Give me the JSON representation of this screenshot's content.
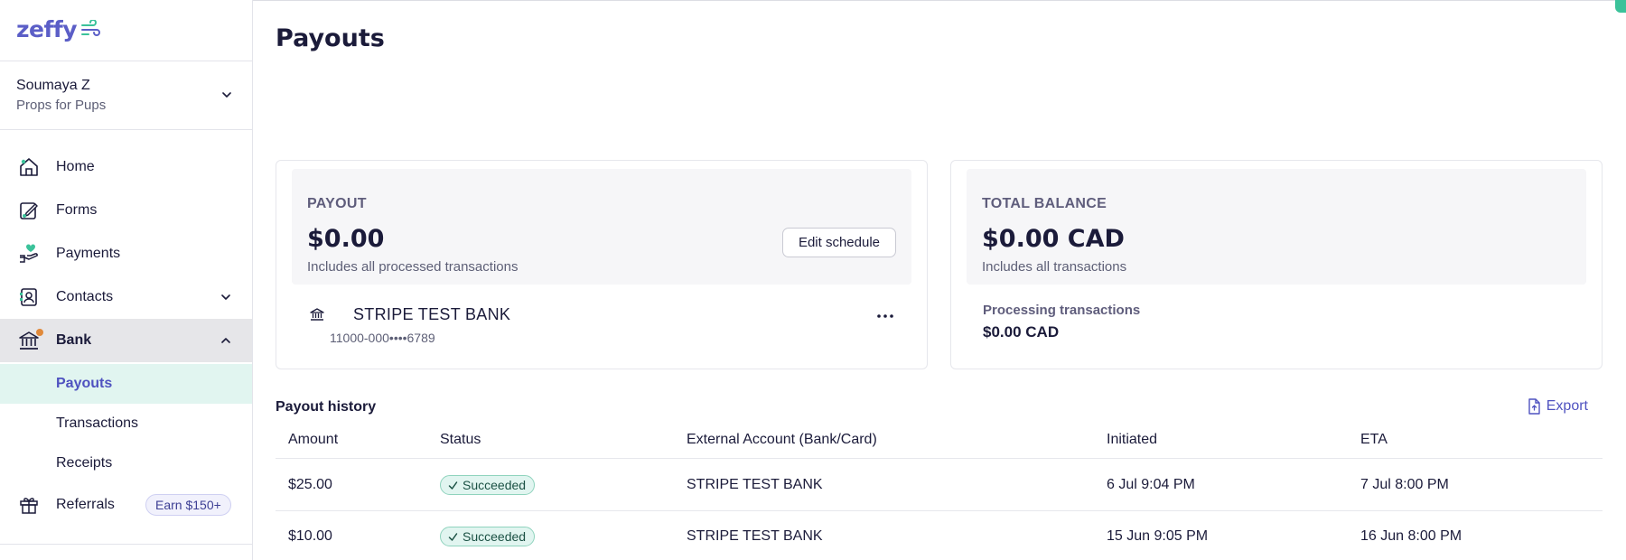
{
  "app": {
    "logo": "zeffy"
  },
  "org": {
    "name": "Soumaya Z",
    "subtitle": "Props for Pups"
  },
  "sidebar": {
    "items": [
      {
        "label": "Home",
        "icon": "home-icon"
      },
      {
        "label": "Forms",
        "icon": "forms-icon"
      },
      {
        "label": "Payments",
        "icon": "payments-icon"
      },
      {
        "label": "Contacts",
        "icon": "contacts-icon"
      },
      {
        "label": "Bank",
        "icon": "bank-icon"
      }
    ],
    "bank_subitems": [
      {
        "label": "Payouts"
      },
      {
        "label": "Transactions"
      },
      {
        "label": "Receipts"
      }
    ],
    "referrals": {
      "label": "Referrals",
      "badge": "Earn $150+"
    }
  },
  "page": {
    "title": "Payouts"
  },
  "payout_card": {
    "label": "PAYOUT",
    "amount": "$0.00",
    "description": "Includes all processed transactions",
    "edit_button": "Edit schedule",
    "bank_name": "STRIPE TEST BANK",
    "account_number": "11000-000••••6789"
  },
  "balance_card": {
    "label": "TOTAL BALANCE",
    "amount": "$0.00 CAD",
    "description": "Includes all transactions",
    "processing_label": "Processing transactions",
    "processing_value": "$0.00 CAD"
  },
  "history": {
    "title": "Payout history",
    "export_label": "Export",
    "columns": [
      "Amount",
      "Status",
      "External Account (Bank/Card)",
      "Initiated",
      "ETA"
    ],
    "rows": [
      {
        "amount": "$25.00",
        "status": "Succeeded",
        "account": "STRIPE TEST BANK",
        "initiated": "6 Jul 9:04 PM",
        "eta": "7 Jul 8:00 PM"
      },
      {
        "amount": "$10.00",
        "status": "Succeeded",
        "account": "STRIPE TEST BANK",
        "initiated": "15 Jun 9:05 PM",
        "eta": "16 Jun 8:00 PM"
      }
    ]
  },
  "colors": {
    "brand": "#5b5ec7",
    "accent_green": "#3bc29a",
    "success_bg": "#e1f5f0",
    "notification_dot": "#e0893a"
  }
}
